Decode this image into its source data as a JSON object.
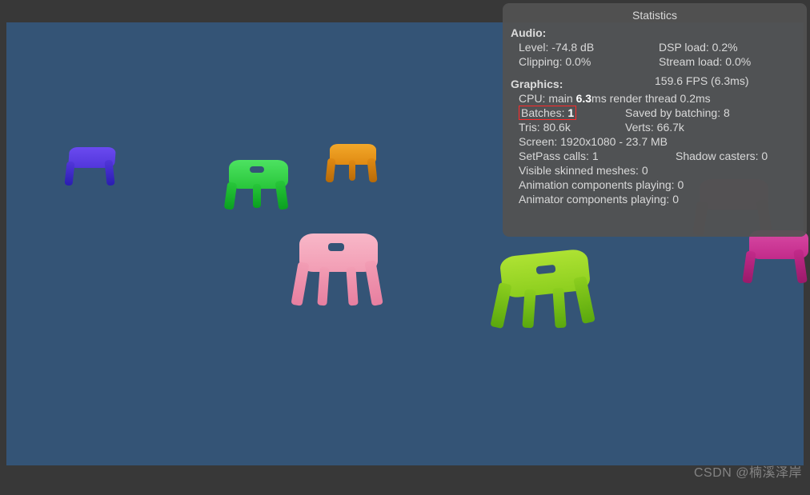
{
  "stats": {
    "title": "Statistics",
    "audio_h": "Audio:",
    "level": "Level: -74.8 dB",
    "clipping": "Clipping: 0.0%",
    "dsp": "DSP load: 0.2%",
    "stream": "Stream load: 0.0%",
    "graphics_h": "Graphics:",
    "fps": "159.6 FPS (6.3ms)",
    "cpu_pre": "CPU: main ",
    "cpu_main": "6.3",
    "cpu_post": "ms  render thread 0.2ms",
    "batches_label": "Batches: ",
    "batches_val": "1",
    "saved": "Saved by batching: 8",
    "tris": "Tris: 80.6k",
    "verts": "Verts: 66.7k",
    "screen": "Screen: 1920x1080 - 23.7 MB",
    "setpass": "SetPass calls: 1",
    "shadow": "Shadow casters: 0",
    "skinned": "Visible skinned meshes: 0",
    "anim": "Animation components playing: 0",
    "animator": "Animator components playing: 0"
  },
  "watermark": "CSDN @楠溪泽岸"
}
